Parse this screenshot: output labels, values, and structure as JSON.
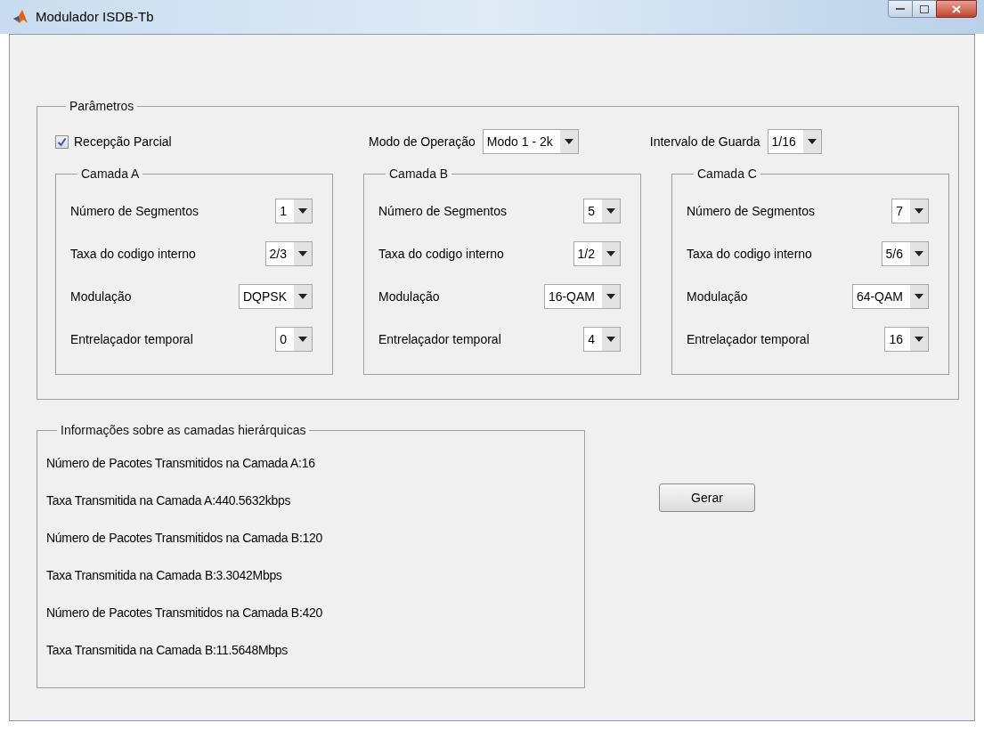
{
  "window": {
    "title": "Modulador ISDB-Tb"
  },
  "parametros": {
    "legend": "Parâmetros",
    "partial_reception": {
      "label": "Recepção Parcial",
      "checked": true
    },
    "mode": {
      "label": "Modo de Operação",
      "value": "Modo 1 - 2k"
    },
    "guard": {
      "label": "Intervalo de Guarda",
      "value": "1/16"
    },
    "layers": [
      {
        "legend": "Camada A",
        "rows": [
          {
            "label": "Número de Segmentos",
            "value": "1"
          },
          {
            "label": "Taxa do codigo interno",
            "value": "2/3"
          },
          {
            "label": "Modulação",
            "value": "DQPSK"
          },
          {
            "label": "Entrelaçador temporal",
            "value": "0"
          }
        ]
      },
      {
        "legend": "Camada B",
        "rows": [
          {
            "label": "Número de Segmentos",
            "value": "5"
          },
          {
            "label": "Taxa do codigo interno",
            "value": "1/2"
          },
          {
            "label": "Modulação",
            "value": "16-QAM"
          },
          {
            "label": "Entrelaçador temporal",
            "value": "4"
          }
        ]
      },
      {
        "legend": "Camada C",
        "rows": [
          {
            "label": "Número de Segmentos",
            "value": "7"
          },
          {
            "label": "Taxa do codigo interno",
            "value": "5/6"
          },
          {
            "label": "Modulação",
            "value": "64-QAM"
          },
          {
            "label": "Entrelaçador temporal",
            "value": "16"
          }
        ]
      }
    ]
  },
  "info": {
    "legend": "Informações sobre as camadas hierárquicas",
    "lines": [
      "Número de Pacotes Transmitidos na Camada A:16",
      "Taxa Transmitida na Camada A:440.5632kbps",
      "Número de Pacotes Transmitidos na Camada B:120",
      "Taxa Transmitida na Camada B:3.3042Mbps",
      "Número de Pacotes Transmitidos na Camada B:420",
      "Taxa Transmitida na Camada B:11.5648Mbps"
    ]
  },
  "button": "Gerar"
}
